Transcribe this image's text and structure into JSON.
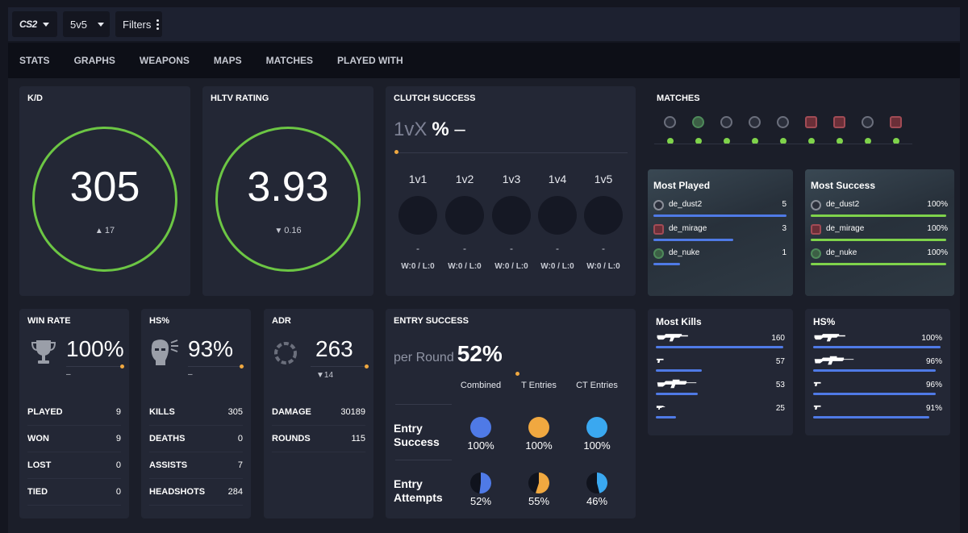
{
  "topbar": {
    "game": "CS2",
    "mode": "5v5",
    "filters": "Filters"
  },
  "nav": [
    "STATS",
    "GRAPHS",
    "WEAPONS",
    "MAPS",
    "MATCHES",
    "PLAYED WITH"
  ],
  "kd": {
    "title": "K/D",
    "value": "305",
    "delta": "17",
    "delta_direction": "up"
  },
  "hltv": {
    "title": "HLTV RATING",
    "value": "3.93",
    "delta": "0.16",
    "delta_direction": "down"
  },
  "clutch": {
    "title": "CLUTCH SUCCESS",
    "prefix": "1vX",
    "pct": "%",
    "value": "–",
    "columns": [
      {
        "label": "1v1",
        "value": "-",
        "wl": "W:0 / L:0"
      },
      {
        "label": "1v2",
        "value": "-",
        "wl": "W:0 / L:0"
      },
      {
        "label": "1v3",
        "value": "-",
        "wl": "W:0 / L:0"
      },
      {
        "label": "1v4",
        "value": "-",
        "wl": "W:0 / L:0"
      },
      {
        "label": "1v5",
        "value": "-",
        "wl": "W:0 / L:0"
      }
    ]
  },
  "matches": {
    "title": "MATCHES",
    "icons": [
      "de_dust2",
      "de_nuke",
      "de_dust2",
      "de_dust2",
      "de_dust2",
      "de_mirage",
      "de_mirage",
      "de_dust2",
      "de_mirage"
    ],
    "results": [
      "win",
      "win",
      "win",
      "win",
      "win",
      "win",
      "win",
      "win",
      "win"
    ]
  },
  "most_played": {
    "title": "Most Played",
    "maps": [
      {
        "name": "de_dust2",
        "value": "5",
        "share": 1.0
      },
      {
        "name": "de_mirage",
        "value": "3",
        "share": 0.6
      },
      {
        "name": "de_nuke",
        "value": "1",
        "share": 0.2
      }
    ]
  },
  "most_success": {
    "title": "Most Success",
    "maps": [
      {
        "name": "de_dust2",
        "value": "100%",
        "share": 1.0
      },
      {
        "name": "de_mirage",
        "value": "100%",
        "share": 1.0
      },
      {
        "name": "de_nuke",
        "value": "100%",
        "share": 1.0
      }
    ]
  },
  "winrate": {
    "title": "WIN RATE",
    "value": "100%",
    "sub": "–",
    "rows": [
      {
        "label": "PLAYED",
        "value": "9"
      },
      {
        "label": "WON",
        "value": "9"
      },
      {
        "label": "LOST",
        "value": "0"
      },
      {
        "label": "TIED",
        "value": "0"
      }
    ]
  },
  "hs": {
    "title": "HS%",
    "value": "93%",
    "sub": "–",
    "rows": [
      {
        "label": "KILLS",
        "value": "305"
      },
      {
        "label": "DEATHS",
        "value": "0"
      },
      {
        "label": "ASSISTS",
        "value": "7"
      },
      {
        "label": "HEADSHOTS",
        "value": "284"
      }
    ]
  },
  "adr": {
    "title": "ADR",
    "value": "263",
    "delta": "14",
    "rows": [
      {
        "label": "DAMAGE",
        "value": "30189"
      },
      {
        "label": "ROUNDS",
        "value": "115"
      }
    ]
  },
  "entry": {
    "title": "ENTRY SUCCESS",
    "prefix": "per Round",
    "value": "52%",
    "columns": [
      "Combined",
      "T Entries",
      "CT Entries"
    ],
    "rows": [
      {
        "label": "Entry Success",
        "values": [
          "100%",
          "100%",
          "100%"
        ],
        "fractions": [
          1.0,
          1.0,
          1.0
        ]
      },
      {
        "label": "Entry Attempts",
        "values": [
          "52%",
          "55%",
          "46%"
        ],
        "fractions": [
          0.52,
          0.55,
          0.46
        ]
      }
    ],
    "colors": [
      "#4f7ae6",
      "#f0a840",
      "#3aa8f0"
    ]
  },
  "most_kills": {
    "title": "Most Kills",
    "weapons": [
      {
        "icon": "rifle-icon",
        "value": "160",
        "share": 1.0
      },
      {
        "icon": "pistol-icon",
        "value": "57",
        "share": 0.36
      },
      {
        "icon": "sniper-icon",
        "value": "53",
        "share": 0.33
      },
      {
        "icon": "smg-icon",
        "value": "25",
        "share": 0.16
      }
    ]
  },
  "weapon_hs": {
    "title": "HS%",
    "weapons": [
      {
        "icon": "rifle-icon",
        "value": "100%",
        "share": 1.0
      },
      {
        "icon": "sniper-icon",
        "value": "96%",
        "share": 0.96
      },
      {
        "icon": "pistol-icon",
        "value": "96%",
        "share": 0.96
      },
      {
        "icon": "pistol-icon",
        "value": "91%",
        "share": 0.91
      }
    ]
  },
  "colors": {
    "green": "#6cc644",
    "blue": "#4f7ae6",
    "orange": "#f0a840",
    "light_green": "#7fd34b"
  }
}
